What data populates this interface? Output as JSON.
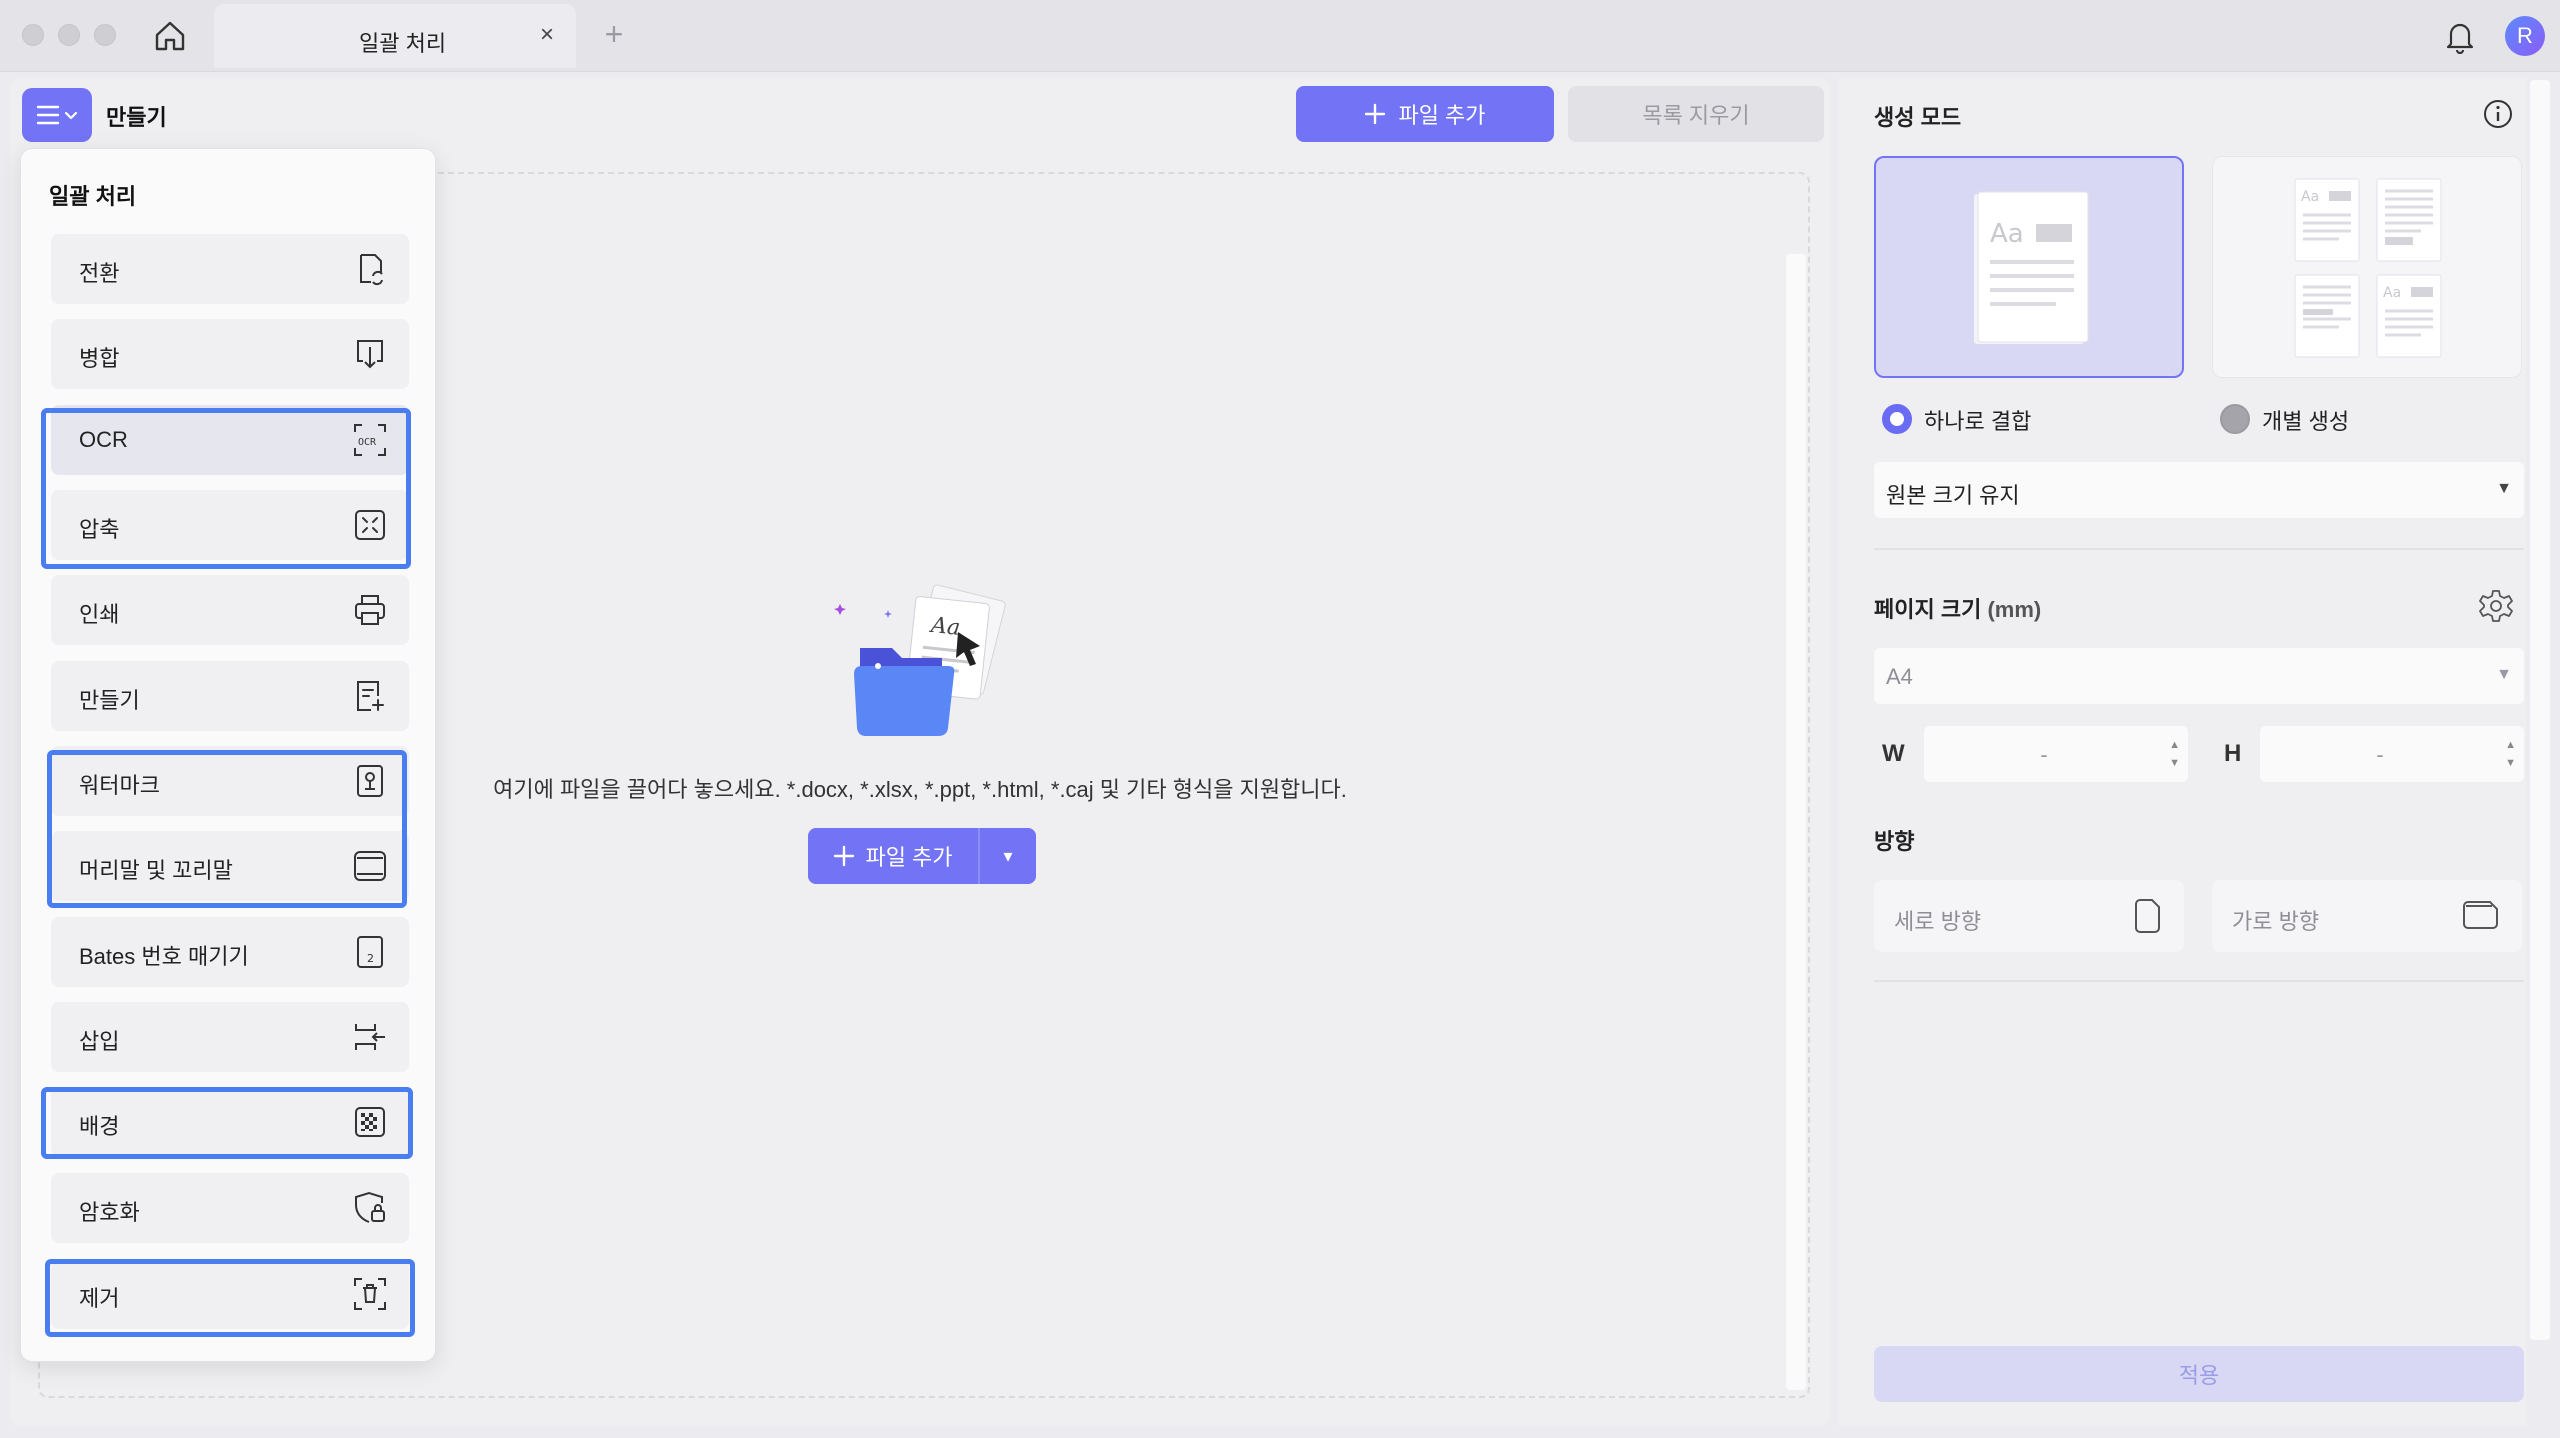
{
  "window": {
    "tab_title": "일괄 처리",
    "tab_close": "×",
    "tab_add": "+",
    "avatar_initial": "R"
  },
  "toolbar": {
    "mode_label": "만들기",
    "add_file_label": "파일 추가",
    "clear_list_label": "목록 지우기"
  },
  "dropzone": {
    "hint": "여기에 파일을 끌어다 놓으세요. *.docx, *.xlsx, *.ppt, *.html, *.caj 및 기타 형식을 지원합니다.",
    "add_file_label": "파일 추가",
    "caret": "▾"
  },
  "menu": {
    "title": "일괄 처리",
    "items": [
      {
        "label": "전환",
        "icon": "convert-icon",
        "highlighted": false
      },
      {
        "label": "병합",
        "icon": "merge-icon",
        "highlighted": false
      },
      {
        "label": "OCR",
        "icon": "ocr-icon",
        "highlighted": true
      },
      {
        "label": "압축",
        "icon": "compress-icon",
        "highlighted": true
      },
      {
        "label": "인쇄",
        "icon": "print-icon",
        "highlighted": false
      },
      {
        "label": "만들기",
        "icon": "create-icon",
        "highlighted": false
      },
      {
        "label": "워터마크",
        "icon": "watermark-icon",
        "highlighted": true
      },
      {
        "label": "머리말 및 꼬리말",
        "icon": "header-footer-icon",
        "highlighted": true
      },
      {
        "label": "Bates 번호 매기기",
        "icon": "bates-number-icon",
        "highlighted": false
      },
      {
        "label": "삽입",
        "icon": "insert-icon",
        "highlighted": false
      },
      {
        "label": "배경",
        "icon": "background-icon",
        "highlighted": true
      },
      {
        "label": "암호화",
        "icon": "encrypt-icon",
        "highlighted": false
      },
      {
        "label": "제거",
        "icon": "remove-icon",
        "highlighted": true
      }
    ]
  },
  "settings": {
    "mode_heading": "생성 모드",
    "mode_combine": "하나로 결합",
    "mode_separate": "개별 생성",
    "selected_mode": "하나로 결합",
    "size_option": "원본 크기 유지",
    "page_size_heading": "페이지 크기",
    "page_size_unit": "(mm)",
    "page_size_value": "A4",
    "width_label": "W",
    "height_label": "H",
    "width_value": "-",
    "height_value": "-",
    "orientation_heading": "방향",
    "portrait_label": "세로 방향",
    "landscape_label": "가로 방향",
    "apply_label": "적용"
  },
  "colors": {
    "accent": "#7374f5",
    "highlight_border": "#4a7df0",
    "selected_card": "#d8d8f4"
  }
}
